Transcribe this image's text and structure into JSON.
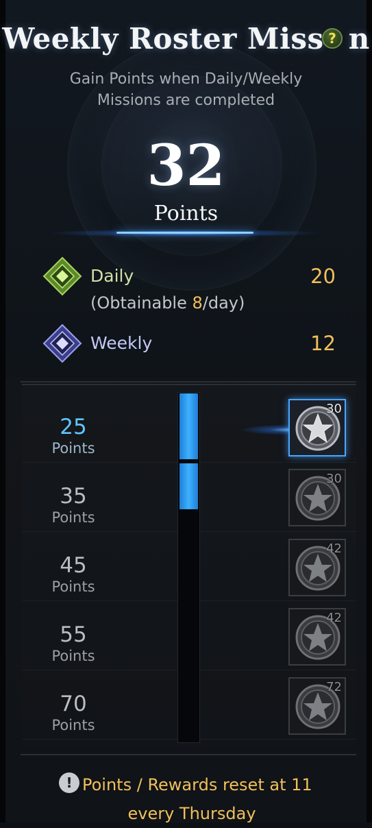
{
  "header": {
    "title": "Weekly Roster Miss",
    "title_tail": "n",
    "help_glyph": "?",
    "subtitle_line1": "Gain Points when Daily/Weekly",
    "subtitle_line2": "Missions are completed"
  },
  "score": {
    "value": "32",
    "label": "Points"
  },
  "categories": [
    {
      "label": "Daily",
      "value": "20",
      "icon": "daily-diamond-icon",
      "color": "#8fc04a"
    },
    {
      "label": "Weekly",
      "value": "12",
      "icon": "weekly-diamond-icon",
      "color": "#8c8ff0"
    }
  ],
  "daily_limit": {
    "prefix": "(Obtainable ",
    "amount": "8",
    "suffix": "/day)"
  },
  "tiers": [
    {
      "points": "25",
      "unit": "Points",
      "reward_count": "30",
      "reached": true
    },
    {
      "points": "35",
      "unit": "Points",
      "reward_count": "30",
      "reached": false
    },
    {
      "points": "45",
      "unit": "Points",
      "reward_count": "42",
      "reached": false
    },
    {
      "points": "55",
      "unit": "Points",
      "reward_count": "42",
      "reached": false
    },
    {
      "points": "70",
      "unit": "Points",
      "reward_count": "72",
      "reached": false
    }
  ],
  "progress": {
    "current": 32,
    "tier_thresholds": [
      25,
      35,
      45,
      55,
      70
    ]
  },
  "footer": {
    "notice_glyph": "!",
    "notice_line1": "Points / Rewards reset at 11",
    "notice_line2": "every Thursday"
  },
  "colors": {
    "accent": "#3fb0ff",
    "gold": "#f0c05a",
    "background": "#0f1419"
  }
}
